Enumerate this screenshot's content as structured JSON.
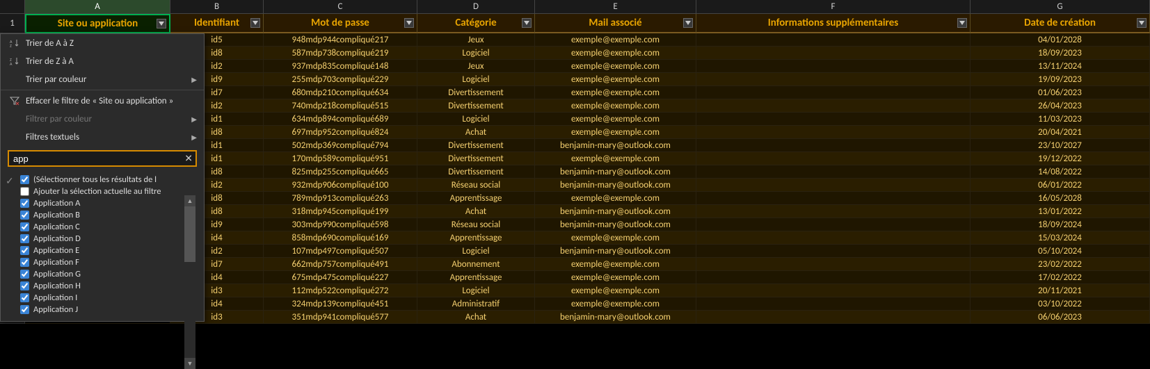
{
  "columns": {
    "letters": [
      "A",
      "B",
      "C",
      "D",
      "E",
      "F",
      "G"
    ],
    "widths": [
      "wA",
      "wB",
      "wC",
      "wD",
      "wE",
      "wF",
      "wG"
    ],
    "headers": [
      "Site ou application",
      "Identifiant",
      "Mot de passe",
      "Catégorie",
      "Mail associé",
      "Informations supplémentaires",
      "Date de création"
    ]
  },
  "active_column_index": 0,
  "first_row_number": "1",
  "rows": [
    {
      "b": "id5",
      "c": "948mdp944compliqué217",
      "d": "Jeux",
      "e": "exemple@exemple.com",
      "f": "",
      "g": "04/01/2028"
    },
    {
      "b": "id8",
      "c": "587mdp738compliqué219",
      "d": "Logiciel",
      "e": "exemple@exemple.com",
      "f": "",
      "g": "18/09/2023"
    },
    {
      "b": "id2",
      "c": "937mdp835compliqué148",
      "d": "Jeux",
      "e": "exemple@exemple.com",
      "f": "",
      "g": "13/11/2024"
    },
    {
      "b": "id9",
      "c": "255mdp703compliqué229",
      "d": "Logiciel",
      "e": "exemple@exemple.com",
      "f": "",
      "g": "19/09/2023"
    },
    {
      "b": "id7",
      "c": "680mdp210compliqué634",
      "d": "Divertissement",
      "e": "exemple@exemple.com",
      "f": "",
      "g": "01/06/2023"
    },
    {
      "b": "id2",
      "c": "740mdp218compliqué515",
      "d": "Divertissement",
      "e": "exemple@exemple.com",
      "f": "",
      "g": "26/04/2023"
    },
    {
      "b": "id1",
      "c": "634mdp894compliqué689",
      "d": "Logiciel",
      "e": "exemple@exemple.com",
      "f": "",
      "g": "11/03/2023"
    },
    {
      "b": "id8",
      "c": "697mdp952compliqué824",
      "d": "Achat",
      "e": "exemple@exemple.com",
      "f": "",
      "g": "20/04/2021"
    },
    {
      "b": "id1",
      "c": "502mdp369compliqué794",
      "d": "Divertissement",
      "e": "benjamin-mary@outlook.com",
      "f": "",
      "g": "23/10/2027"
    },
    {
      "b": "id1",
      "c": "170mdp589compliqué951",
      "d": "Divertissement",
      "e": "exemple@exemple.com",
      "f": "",
      "g": "19/12/2022"
    },
    {
      "b": "id8",
      "c": "825mdp255compliqué665",
      "d": "Divertissement",
      "e": "benjamin-mary@outlook.com",
      "f": "",
      "g": "14/08/2022"
    },
    {
      "b": "id2",
      "c": "932mdp906compliqué100",
      "d": "Réseau social",
      "e": "benjamin-mary@outlook.com",
      "f": "",
      "g": "06/01/2022"
    },
    {
      "b": "id8",
      "c": "789mdp913compliqué263",
      "d": "Apprentissage",
      "e": "exemple@exemple.com",
      "f": "",
      "g": "16/05/2028"
    },
    {
      "b": "id8",
      "c": "318mdp945compliqué199",
      "d": "Achat",
      "e": "benjamin-mary@outlook.com",
      "f": "",
      "g": "13/01/2022"
    },
    {
      "b": "id9",
      "c": "303mdp990compliqué598",
      "d": "Réseau social",
      "e": "benjamin-mary@outlook.com",
      "f": "",
      "g": "18/09/2024"
    },
    {
      "b": "id4",
      "c": "858mdp690compliqué169",
      "d": "Apprentissage",
      "e": "exemple@exemple.com",
      "f": "",
      "g": "15/03/2024"
    },
    {
      "b": "id2",
      "c": "107mdp497compliqué507",
      "d": "Logiciel",
      "e": "benjamin-mary@outlook.com",
      "f": "",
      "g": "05/10/2024"
    },
    {
      "b": "id7",
      "c": "662mdp757compliqué491",
      "d": "Abonnement",
      "e": "exemple@exemple.com",
      "f": "",
      "g": "23/02/2022"
    },
    {
      "b": "id4",
      "c": "675mdp475compliqué227",
      "d": "Apprentissage",
      "e": "exemple@exemple.com",
      "f": "",
      "g": "17/02/2022"
    },
    {
      "b": "id3",
      "c": "112mdp522compliqué272",
      "d": "Logiciel",
      "e": "exemple@exemple.com",
      "f": "",
      "g": "20/11/2021"
    },
    {
      "b": "id4",
      "c": "324mdp139compliqué451",
      "d": "Administratif",
      "e": "exemple@exemple.com",
      "f": "",
      "g": "03/10/2022"
    },
    {
      "b": "id3",
      "c": "351mdp941compliqué577",
      "d": "Achat",
      "e": "benjamin-mary@outlook.com",
      "f": "",
      "g": "06/06/2023"
    }
  ],
  "dropdown": {
    "sort_az": "Trier de A à Z",
    "sort_za": "Trier de Z à A",
    "sort_color": "Trier par couleur",
    "clear_filter": "Effacer le filtre de « Site ou application »",
    "filter_color": "Filtrer par couleur",
    "text_filters": "Filtres textuels",
    "search_value": "app",
    "select_all": "(Sélectionner tous les résultats de l",
    "add_current": "Ajouter la sélection actuelle au filtre",
    "items": [
      "Application A",
      "Application B",
      "Application C",
      "Application D",
      "Application E",
      "Application F",
      "Application G",
      "Application H",
      "Application I",
      "Application J"
    ]
  }
}
